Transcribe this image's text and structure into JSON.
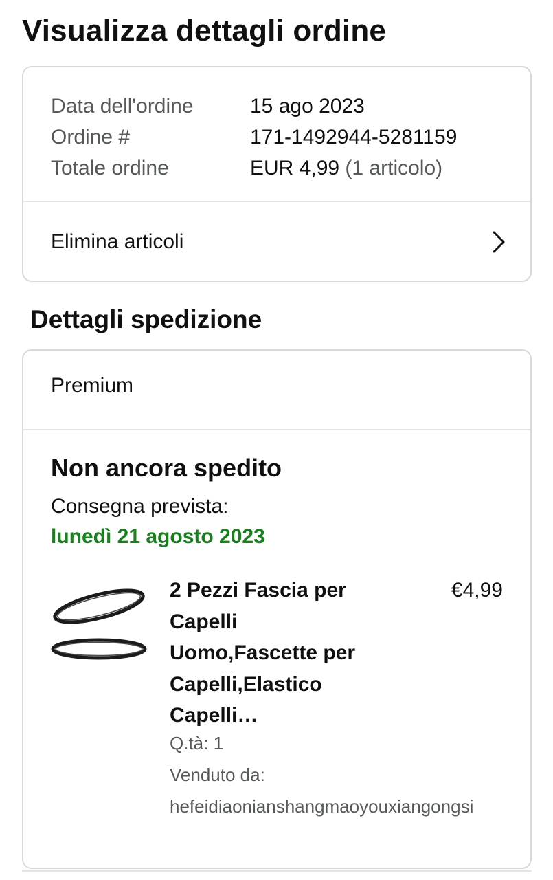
{
  "page": {
    "title": "Visualizza dettagli ordine"
  },
  "order_summary": {
    "date_label": "Data dell'ordine",
    "date_value": "15 ago 2023",
    "number_label": "Ordine #",
    "number_value": "171-1492944-5281159",
    "total_label": "Totale ordine",
    "total_value": "EUR 4,99",
    "total_items": "(1 articolo)",
    "remove_items_label": "Elimina articoli"
  },
  "shipping": {
    "section_title": "Dettagli spedizione",
    "shipping_type": "Premium",
    "status": "Non ancora spedito",
    "delivery_label": "Consegna prevista:",
    "delivery_date": "lunedì 21 agosto 2023",
    "delivery_date_color": "#1a7f1e"
  },
  "product": {
    "title": "2 Pezzi Fascia per Capelli Uomo,Fascette per Capelli,Elastico Capelli…",
    "price": "€4,99",
    "quantity": "Q.tà: 1",
    "seller_label": "Venduto da:",
    "seller_name": "hefeidiaonianshangmaoyouxiangongsi",
    "image_icon": "headband-image"
  },
  "icons": {
    "chevron": "chevron-right-icon"
  }
}
